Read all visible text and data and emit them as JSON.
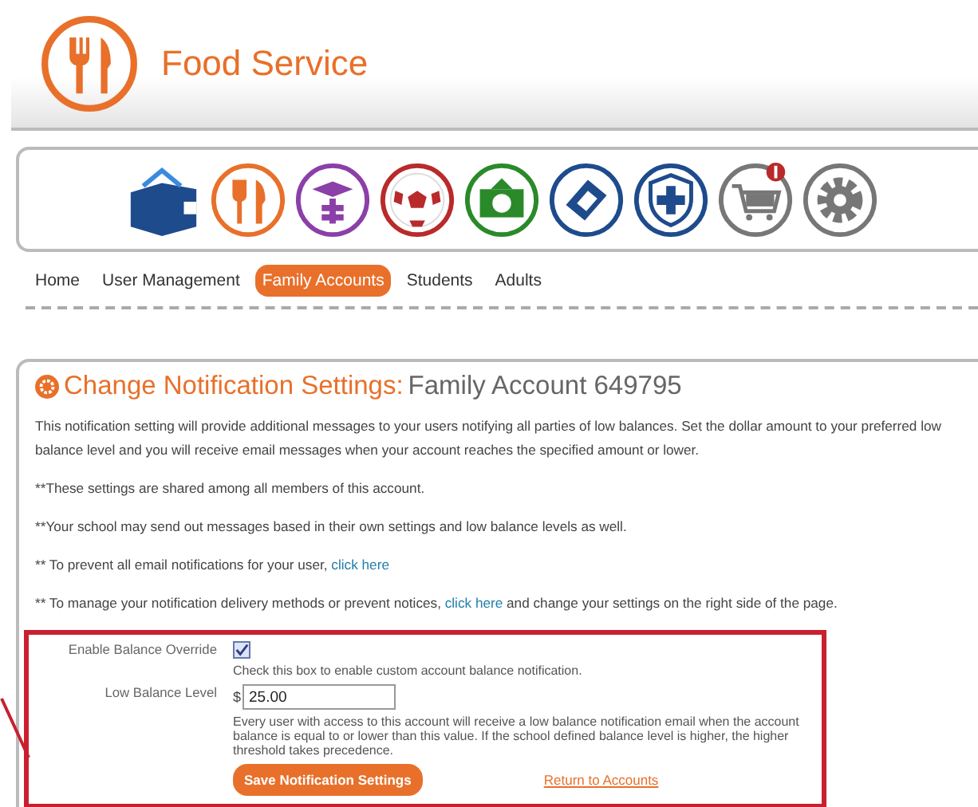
{
  "header": {
    "title": "Food Service"
  },
  "app_icons": [
    {
      "kind": "wallet"
    },
    {
      "kind": "food"
    },
    {
      "kind": "scholar"
    },
    {
      "kind": "sport"
    },
    {
      "kind": "money"
    },
    {
      "kind": "ticket"
    },
    {
      "kind": "health"
    },
    {
      "kind": "cart"
    },
    {
      "kind": "settings"
    }
  ],
  "tabs": [
    {
      "label": "Home",
      "selected": false
    },
    {
      "label": "User Management",
      "selected": false
    },
    {
      "label": "Family Accounts",
      "selected": true
    },
    {
      "label": "Students",
      "selected": false
    },
    {
      "label": "Adults",
      "selected": false
    }
  ],
  "panel": {
    "title": "Change Notification Settings:",
    "subtitle": "Family Account 649795",
    "paragraphs": [
      {
        "text": "This notification setting will provide additional messages to your users notifying all parties of low balances. Set the dollar amount to your preferred low balance level and you will receive email messages when your account reaches the specified amount or lower."
      },
      {
        "text": "**These settings are shared among all members of this account."
      },
      {
        "text": "**Your school may send out messages based in their own settings and low balance levels as well."
      },
      {
        "text": "** To prevent all email notifications for your user,",
        "link": "click here"
      },
      {
        "text": "** To manage your notification delivery methods or prevent notices,",
        "link": "click here",
        "after": "and change your settings on the right side of the page."
      }
    ],
    "form": {
      "override_label": "Enable Balance Override",
      "override_checked": true,
      "override_help": "Check this box to enable custom account balance notification.",
      "level_label": "Low Balance Level",
      "currency": "$",
      "level_value": "25.00",
      "level_help": "Every user with access to this account will receive a low balance notification email when the account balance is equal to or lower than this value. If the school defined balance level is higher, the higher threshold takes precedence.",
      "save_button": "Save Notification Settings",
      "return_link": "Return to Accounts"
    }
  }
}
